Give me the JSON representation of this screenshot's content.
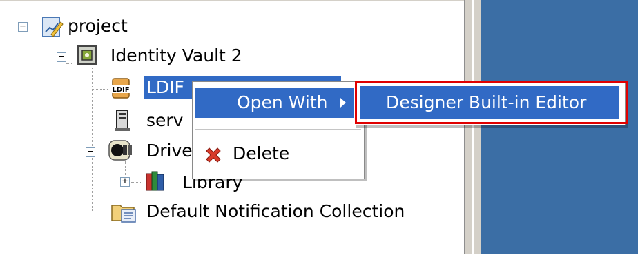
{
  "tree": {
    "items": [
      {
        "label": "project",
        "icon": "project-icon"
      },
      {
        "label": "Identity Vault 2",
        "icon": "identity-vault-icon"
      },
      {
        "label": "LDIF",
        "icon": "ldif-icon"
      },
      {
        "label": "serv",
        "icon": "server-icon"
      },
      {
        "label": "Drive",
        "icon": "driver-set-icon"
      },
      {
        "label": "Library",
        "icon": "library-icon"
      },
      {
        "label": "Default Notification Collection",
        "icon": "notification-collection-icon"
      }
    ],
    "ldif_badge": "LDIF"
  },
  "context_menu": {
    "open_with_label": "Open With",
    "delete_label": "Delete"
  },
  "submenu": {
    "item_label": "Designer Built-in Editor"
  },
  "colors": {
    "selection": "#316ac5",
    "right_pane": "#3b6ea5",
    "highlight_frame": "#e00000"
  }
}
